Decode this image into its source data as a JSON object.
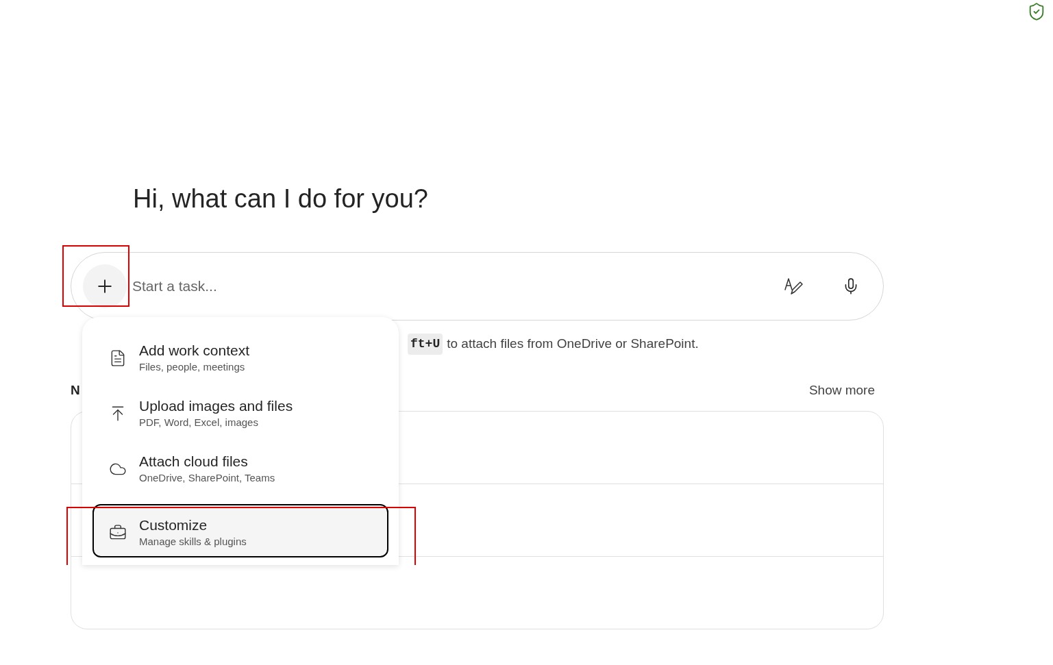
{
  "heading": "Hi, what can I do for you?",
  "composer": {
    "placeholder": "Start a task..."
  },
  "hint": {
    "key": "ft+U",
    "text": "to attach files from OneDrive or SharePoint."
  },
  "section": {
    "title": "N",
    "action": "Show more"
  },
  "menu": {
    "items": [
      {
        "kind": "document",
        "title": "Add work context",
        "subtitle": "Files, people, meetings",
        "selected": false
      },
      {
        "kind": "upload",
        "title": "Upload images and files",
        "subtitle": "PDF, Word, Excel, images",
        "selected": false
      },
      {
        "kind": "cloud",
        "title": "Attach cloud files",
        "subtitle": "OneDrive, SharePoint, Teams",
        "selected": false
      },
      {
        "kind": "toolbox",
        "title": "Customize",
        "subtitle": "Manage skills & plugins",
        "selected": true
      }
    ]
  }
}
